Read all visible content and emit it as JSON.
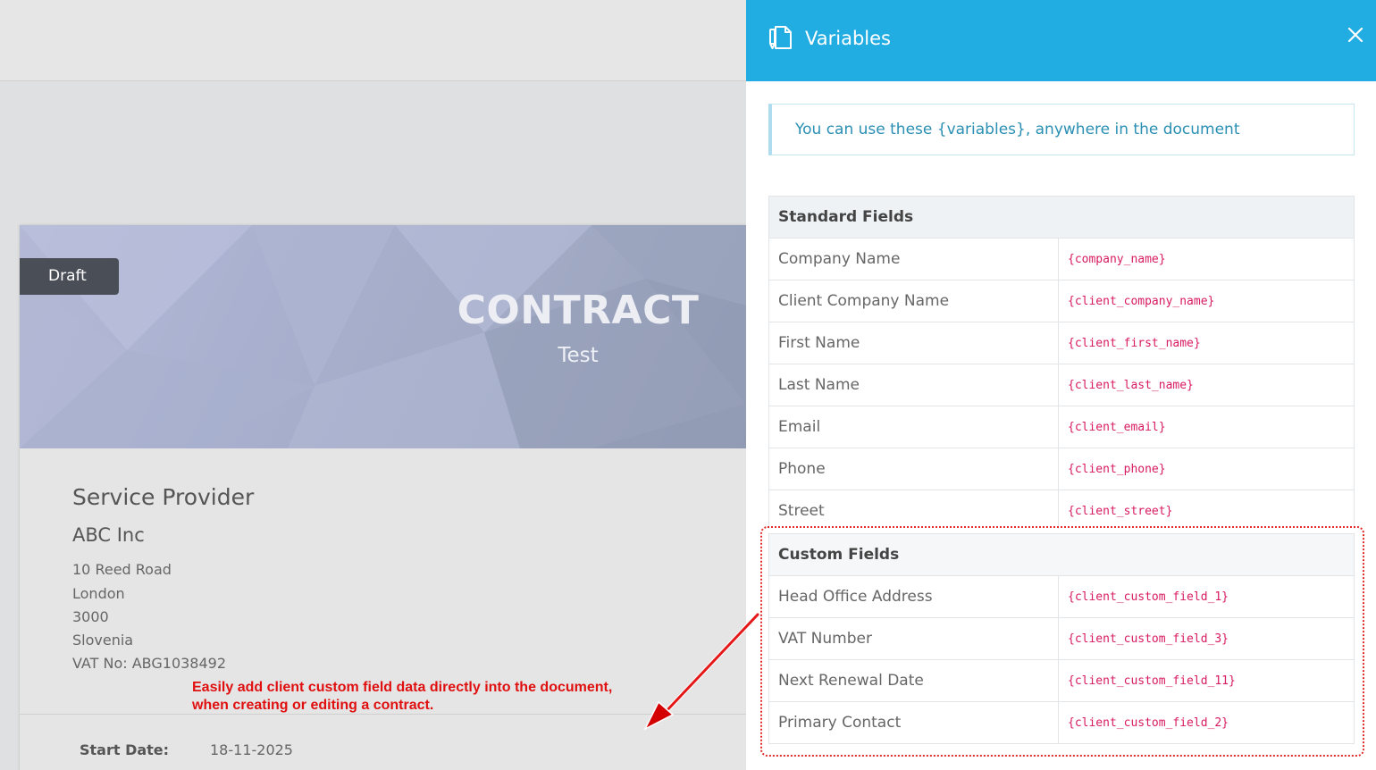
{
  "document": {
    "status_badge": "Draft",
    "title": "CONTRACT",
    "subtitle": "Test",
    "service_provider_heading": "Service Provider",
    "company": "ABC Inc",
    "address_lines": [
      "10 Reed Road",
      "London",
      "3000",
      "Slovenia",
      "VAT No: ABG1038492"
    ],
    "start_date_label": "Start Date:",
    "start_date_value": "18-11-2025"
  },
  "annotation": {
    "line1": "Easily add client custom field data directly into the document,",
    "line2": "when creating or editing a contract.",
    "color": "#e01010"
  },
  "panel": {
    "title": "Variables",
    "header_color": "#21ade2",
    "info_text": "You can use these {variables}, anywhere in the document",
    "standard_heading": "Standard Fields",
    "standard_fields": [
      {
        "label": "Company Name",
        "var": "{company_name}"
      },
      {
        "label": "Client Company Name",
        "var": "{client_company_name}"
      },
      {
        "label": "First Name",
        "var": "{client_first_name}"
      },
      {
        "label": "Last Name",
        "var": "{client_last_name}"
      },
      {
        "label": "Email",
        "var": "{client_email}"
      },
      {
        "label": "Phone",
        "var": "{client_phone}"
      },
      {
        "label": "Street",
        "var": "{client_street}"
      }
    ],
    "custom_heading": "Custom Fields",
    "custom_fields": [
      {
        "label": "Head Office Address",
        "var": "{client_custom_field_1}"
      },
      {
        "label": "VAT Number",
        "var": "{client_custom_field_3}"
      },
      {
        "label": "Next Renewal Date",
        "var": "{client_custom_field_11}"
      },
      {
        "label": "Primary Contact",
        "var": "{client_custom_field_2}"
      }
    ],
    "icons": {
      "header": "document-icon",
      "close": "close-icon"
    }
  }
}
